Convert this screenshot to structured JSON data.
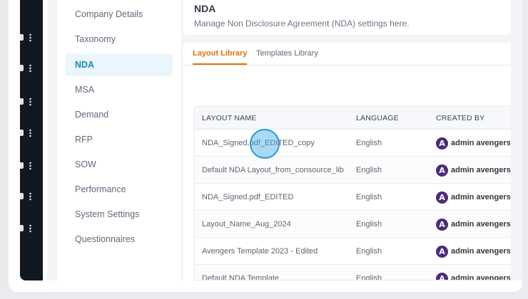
{
  "page": {
    "title": "NDA",
    "subtitle": "Manage Non Disclosure Agreement (NDA) settings here."
  },
  "sidebar": {
    "items": [
      {
        "label": "Company Details"
      },
      {
        "label": "Taxonomy"
      },
      {
        "label": "NDA",
        "active": true
      },
      {
        "label": "MSA"
      },
      {
        "label": "Demand"
      },
      {
        "label": "RFP"
      },
      {
        "label": "SOW"
      },
      {
        "label": "Performance"
      },
      {
        "label": "System Settings"
      },
      {
        "label": "Questionnaires"
      }
    ]
  },
  "tabs": [
    {
      "label": "Layout Library",
      "active": true
    },
    {
      "label": "Templates Library",
      "active": false
    }
  ],
  "table": {
    "headers": [
      "LAYOUT NAME",
      "LANGUAGE",
      "CREATED BY"
    ],
    "rows": [
      {
        "name": "NDA_Signed.pdf_EDITED_copy",
        "language": "English",
        "created_by": "admin avengers"
      },
      {
        "name": "Default NDA Layout_from_consource_lib",
        "language": "English",
        "created_by": "admin avengers"
      },
      {
        "name": "NDA_Signed.pdf_EDITED",
        "language": "English",
        "created_by": "admin avengers"
      },
      {
        "name": "Layout_Name_Aug_2024",
        "language": "English",
        "created_by": "admin avengers"
      },
      {
        "name": "Avengers Template 2023 - Edited",
        "language": "English",
        "created_by": "admin avengers"
      },
      {
        "name": "Default NDA Template",
        "language": "English",
        "created_by": "admin avengers"
      }
    ]
  },
  "icons": {
    "rail": [
      "nav-icon",
      "nav-icon",
      "nav-icon",
      "nav-icon",
      "nav-icon",
      "nav-icon",
      "nav-icon"
    ],
    "avatar": "avengers-avatar-icon",
    "more": "kebab-menu-icon"
  },
  "colors": {
    "accent_tab": "#e0720f",
    "accent_sidebar": "#1689b8",
    "rail": "#111820"
  }
}
